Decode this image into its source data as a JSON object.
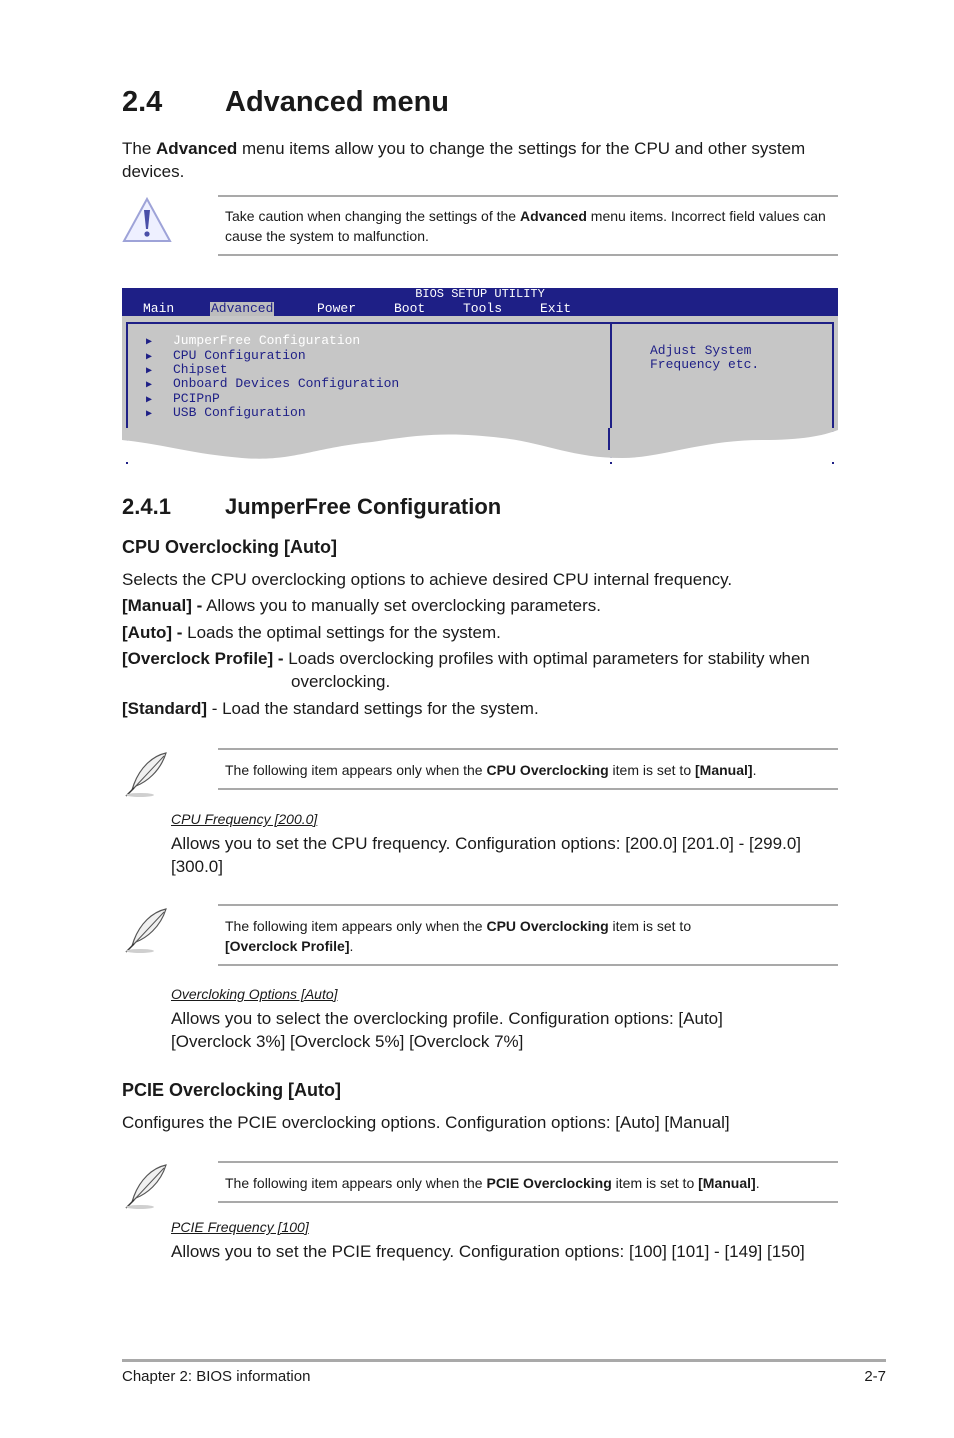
{
  "section": {
    "number": "2.4",
    "title": "Advanced menu"
  },
  "intro": {
    "pre": "The ",
    "bold": "Advanced",
    "post": " menu items allow you to change the settings for the CPU and other system devices."
  },
  "caution": {
    "icon": "warning-triangle-icon",
    "pre": "Take caution when changing the settings of the ",
    "bold": "Advanced",
    "post": " menu items. Incorrect field values can cause the system to malfunction."
  },
  "bios": {
    "title": "BIOS SETUP UTILITY",
    "menu": [
      "Main",
      "Advanced",
      "Power",
      "Boot",
      "Tools",
      "Exit"
    ],
    "active_menu": "Advanced",
    "items": [
      "JumperFree Configuration",
      "CPU Configuration",
      "Chipset",
      "Onboard Devices Configuration",
      "PCIPnP",
      "USB Configuration"
    ],
    "selected_item": "JumperFree Configuration",
    "help": [
      "Adjust System",
      "Frequency etc."
    ],
    "colors": {
      "bar": "#1e1f86",
      "body": "#c6c6c6",
      "text": "#1e1f86"
    }
  },
  "subsection": {
    "number": "2.4.1",
    "title": "JumperFree Configuration"
  },
  "cpu_oc": {
    "heading": "CPU Overclocking [Auto]",
    "desc": "Selects the CPU overclocking options to achieve desired CPU internal frequency.",
    "options": [
      {
        "label": "[Manual] -",
        "text": " Allows you to manually set overclocking parameters."
      },
      {
        "label": "[Auto] -",
        "text": " Loads the optimal settings for the system."
      },
      {
        "label": "[Overclock Profile] -",
        "text": " Loads overclocking profiles with optimal parameters for stability when",
        "cont": "overclocking."
      },
      {
        "label": "[Standard]",
        "text": " - Load the standard settings for the system."
      }
    ]
  },
  "note1": {
    "pre": "The following item appears only when the ",
    "bold": "CPU Overclocking",
    "mid": " item is set to ",
    "bold2": "[Manual]",
    "post": "."
  },
  "cpu_freq": {
    "title": "CPU Frequency [200.0]",
    "desc": "Allows you to set the CPU frequency. Configuration options: [200.0] [201.0] - [299.0] [300.0]"
  },
  "note2": {
    "pre": "The following item appears only when the ",
    "bold": "CPU Overclocking",
    "mid": " item is set to ",
    "bold2": "[Overclock Profile]",
    "post": "."
  },
  "oc_options": {
    "title": "Overcloking Options [Auto]",
    "desc": "Allows you to select the overclocking profile. Configuration options: [Auto] [Overclock 3%] [Overclock 5%] [Overclock 7%]"
  },
  "pcie_oc": {
    "heading": "PCIE Overclocking [Auto]",
    "desc": "Configures the PCIE overclocking options. Configuration options: [Auto] [Manual]"
  },
  "note3": {
    "pre": "The following item appears only when the ",
    "bold": "PCIE Overclocking",
    "mid": " item is set to ",
    "bold2": "[Manual]",
    "post": "."
  },
  "pcie_freq": {
    "title": "PCIE Frequency [100]",
    "desc": "Allows you to set the PCIE frequency. Configuration options: [100] [101] - [149] [150]"
  },
  "footer": {
    "left": "Chapter 2: BIOS information",
    "right": "2-7"
  }
}
